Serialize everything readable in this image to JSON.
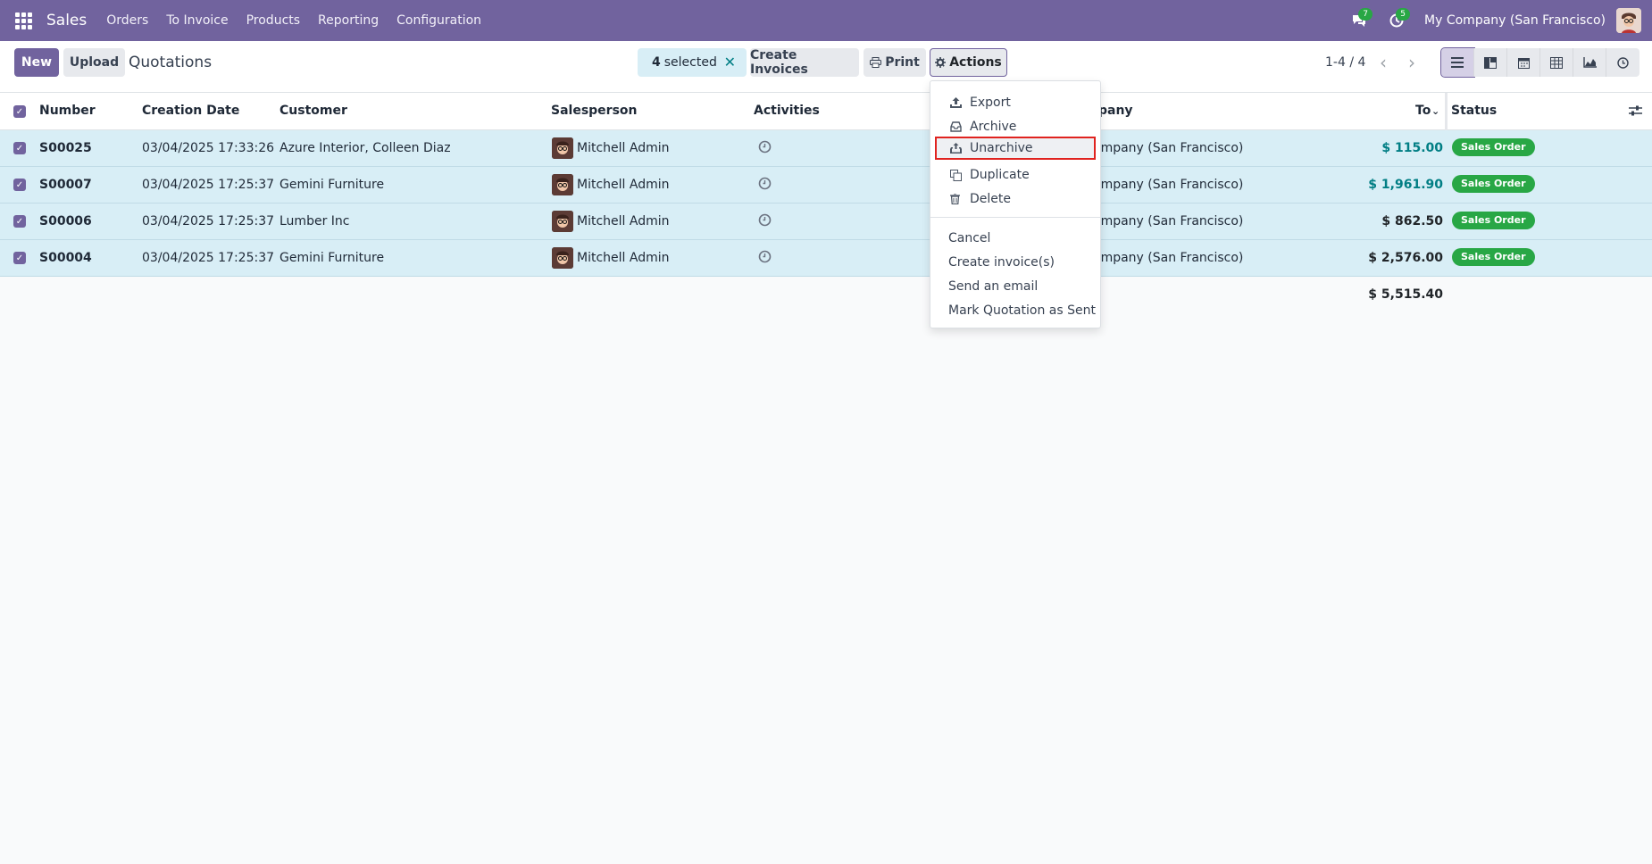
{
  "navbar": {
    "app_name": "Sales",
    "menu": [
      "Orders",
      "To Invoice",
      "Products",
      "Reporting",
      "Configuration"
    ],
    "messages_count": "7",
    "activities_count": "5",
    "company": "My Company (San Francisco)"
  },
  "control_panel": {
    "new_label": "New",
    "upload_label": "Upload",
    "title": "Quotations",
    "selected_count": "4",
    "selected_text": "selected",
    "create_invoices_label": "Create Invoices",
    "print_label": "Print",
    "actions_label": "Actions",
    "pager": "1-4 / 4"
  },
  "table": {
    "headers": {
      "number": "Number",
      "creation_date": "Creation Date",
      "customer": "Customer",
      "salesperson": "Salesperson",
      "activities": "Activities",
      "company": "pany",
      "total": "To",
      "status": "Status"
    },
    "rows": [
      {
        "number": "S00025",
        "date": "03/04/2025 17:33:26",
        "customer": "Azure Interior, Colleen Diaz",
        "salesperson": "Mitchell Admin",
        "company": "ompany (San Francisco)",
        "total": "$ 115.00",
        "status": "Sales Order"
      },
      {
        "number": "S00007",
        "date": "03/04/2025 17:25:37",
        "customer": "Gemini Furniture",
        "salesperson": "Mitchell Admin",
        "company": "ompany (San Francisco)",
        "total": "$ 1,961.90",
        "status": "Sales Order"
      },
      {
        "number": "S00006",
        "date": "03/04/2025 17:25:37",
        "customer": "Lumber Inc",
        "salesperson": "Mitchell Admin",
        "company": "ompany (San Francisco)",
        "total": "$ 862.50",
        "status": "Sales Order"
      },
      {
        "number": "S00004",
        "date": "03/04/2025 17:25:37",
        "customer": "Gemini Furniture",
        "salesperson": "Mitchell Admin",
        "company": "ompany (San Francisco)",
        "total": "$ 2,576.00",
        "status": "Sales Order"
      }
    ],
    "sum_total": "$ 5,515.40"
  },
  "actions_menu": {
    "export": "Export",
    "archive": "Archive",
    "unarchive": "Unarchive",
    "duplicate": "Duplicate",
    "delete": "Delete",
    "cancel": "Cancel",
    "create_invoices": "Create invoice(s)",
    "send_email": "Send an email",
    "mark_sent": "Mark Quotation as Sent"
  },
  "colors": {
    "brand": "#71639e",
    "selected_row": "#d8eef6",
    "status_green": "#28a745",
    "highlight_border": "#e0231f"
  }
}
